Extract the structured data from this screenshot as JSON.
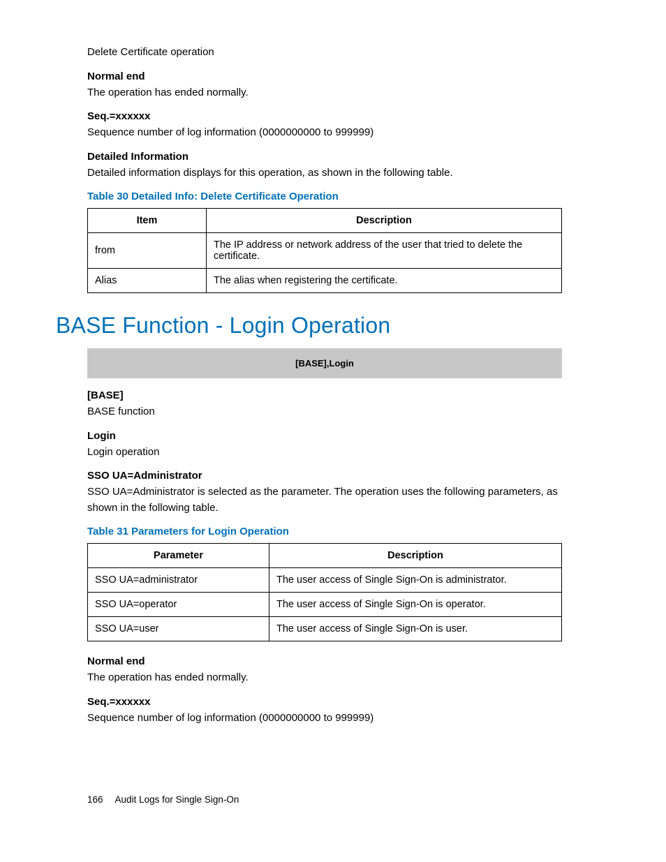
{
  "top": {
    "line1": "Delete Certificate operation",
    "normal_end_label": "Normal end",
    "normal_end_text": "The operation has ended normally.",
    "seq_label": "Seq.=xxxxxx",
    "seq_text": "Sequence number of log information (0000000000 to 999999)",
    "detailed_label": "Detailed Information",
    "detailed_text": "Detailed information displays for this operation, as shown in the following table."
  },
  "table30": {
    "caption": "Table 30 Detailed Info: Delete Certificate Operation",
    "h1": "Item",
    "h2": "Description",
    "r1c1": "from",
    "r1c2": "The IP address or network address of the user that tried to delete the certificate.",
    "r2c1": "Alias",
    "r2c2": "The alias when registering the certificate."
  },
  "section": {
    "heading": "BASE Function - Login Operation",
    "banner": "[BASE],Login",
    "base_label": "[BASE]",
    "base_text": "BASE function",
    "login_label": "Login",
    "login_text": "Login operation",
    "sso_label": "SSO UA=Administrator",
    "sso_text": "SSO UA=Administrator is selected as the parameter. The operation uses the following parameters, as shown in the following table."
  },
  "table31": {
    "caption": "Table 31 Parameters for Login Operation",
    "h1": "Parameter",
    "h2": "Description",
    "r1c1": "SSO UA=administrator",
    "r1c2": "The user access of Single Sign-On is administrator.",
    "r2c1": "SSO UA=operator",
    "r2c2": "The user access of Single Sign-On is operator.",
    "r3c1": "SSO UA=user",
    "r3c2": "The user access of Single Sign-On is user."
  },
  "bottom": {
    "normal_end_label": "Normal end",
    "normal_end_text": "The operation has ended normally.",
    "seq_label": "Seq.=xxxxxx",
    "seq_text": "Sequence number of log information (0000000000 to 999999)"
  },
  "footer": {
    "page_number": "166",
    "title": "Audit Logs for Single Sign-On"
  }
}
